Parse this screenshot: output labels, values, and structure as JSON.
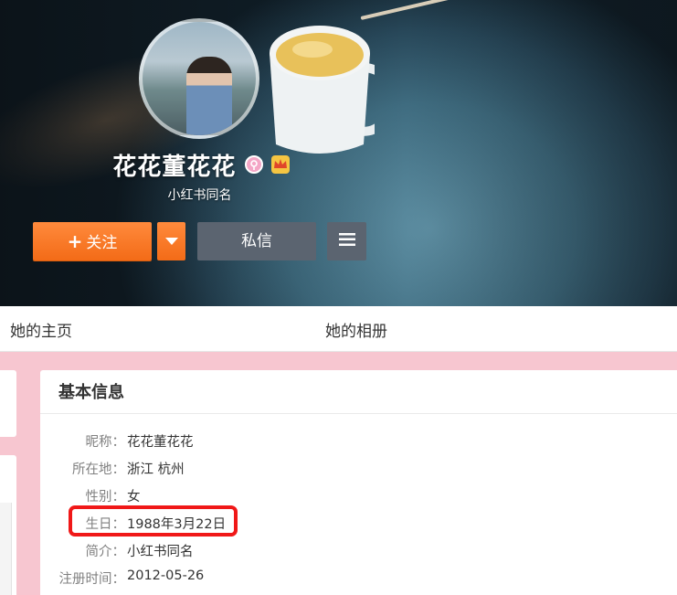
{
  "profile": {
    "name": "花花董花花",
    "subtitle": "小红书同名",
    "buttons": {
      "follow_icon": "+",
      "follow_label": "关注",
      "dropdown_icon": "caret-down-icon",
      "message_label": "私信",
      "more_icon": "menu-icon"
    },
    "badges": [
      "female-badge-icon",
      "vip-crown-icon"
    ]
  },
  "tabs": [
    {
      "label": "她的主页"
    },
    {
      "label": "她的相册"
    }
  ],
  "info": {
    "title": "基本信息",
    "rows": [
      {
        "label": "昵称：",
        "value": "花花董花花"
      },
      {
        "label": "所在地：",
        "value": "浙江 杭州"
      },
      {
        "label": "性别：",
        "value": "女"
      },
      {
        "label": "生日：",
        "value": "1988年3月22日"
      },
      {
        "label": "简介：",
        "value": "小红书同名"
      },
      {
        "label": "注册时间：",
        "value": "2012-05-26"
      }
    ]
  },
  "colors": {
    "accent_orange": "#f36b17",
    "button_gray": "#5b6470",
    "page_pink": "#f7c6d0",
    "highlight_red": "#f01818"
  }
}
